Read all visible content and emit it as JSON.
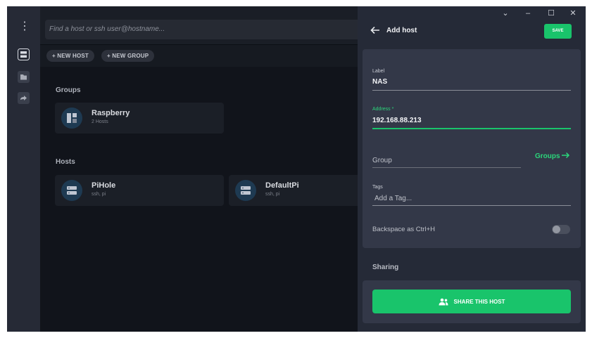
{
  "search": {
    "placeholder": "Find a host or ssh user@hostname..."
  },
  "toolbar": {
    "new_host": "+ NEW HOST",
    "new_group": "+ NEW GROUP"
  },
  "groups": {
    "title": "Groups",
    "items": [
      {
        "name": "Raspberry",
        "sub": "2 Hosts",
        "icon": "grid-icon"
      }
    ]
  },
  "hosts": {
    "title": "Hosts",
    "items": [
      {
        "name": "PiHole",
        "sub": "ssh, pi",
        "icon": "server-icon"
      },
      {
        "name": "DefaultPi",
        "sub": "ssh, pi",
        "icon": "server-icon"
      }
    ]
  },
  "window": {
    "minimize": "–",
    "maximize": "☐",
    "close": "✕",
    "dropdown": "⌄"
  },
  "panel": {
    "title": "Add host",
    "save": "SAVE",
    "label_label": "Label",
    "label_value": "NAS",
    "address_label": "Address *",
    "address_value": "192.168.88.213",
    "group_placeholder": "Group",
    "groups_link": "Groups",
    "tags_label": "Tags",
    "tags_placeholder": "Add a Tag...",
    "backspace_label": "Backspace as Ctrl+H",
    "backspace_enabled": false,
    "sharing_title": "Sharing",
    "share_button": "SHARE THIS HOST"
  },
  "colors": {
    "accent": "#19c46b",
    "panel": "#252a37",
    "form": "#333848"
  }
}
